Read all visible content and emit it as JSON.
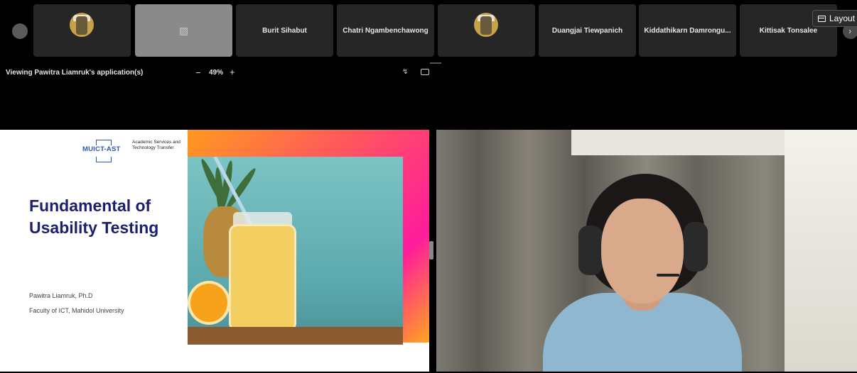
{
  "toolbar": {
    "layout_label": "Layout"
  },
  "participants": [
    {
      "name": "",
      "type": "avatar"
    },
    {
      "name": "",
      "type": "placeholder",
      "selected": true
    },
    {
      "name": "Burit Sihabut",
      "type": "name"
    },
    {
      "name": "Chatri Ngambenchawong",
      "type": "name"
    },
    {
      "name": "",
      "type": "avatar"
    },
    {
      "name": "Duangjai Tiewpanich",
      "type": "name"
    },
    {
      "name": "Kiddathikarn Damrongu...",
      "type": "name"
    },
    {
      "name": "Kittisak Tonsalee",
      "type": "name"
    }
  ],
  "share": {
    "viewing_label": "Viewing Pawitra Liamruk's application(s)",
    "zoom_minus": "−",
    "zoom_value": "49%",
    "zoom_plus": "+"
  },
  "slide": {
    "logo_mark": "MUICT-AST",
    "logo_text": "Academic Services and Technology Transfer",
    "title": "Fundamental of Usability Testing",
    "author": "Pawitra Liamruk, Ph.D",
    "affiliation": "Faculty of ICT, Mahidol University"
  },
  "icons": {
    "nav_left": "circle-button-icon",
    "nav_right": "chevron-right-icon",
    "layout": "layout-icon",
    "share_tool_a": "pop-out-icon",
    "share_tool_b": "window-icon"
  }
}
